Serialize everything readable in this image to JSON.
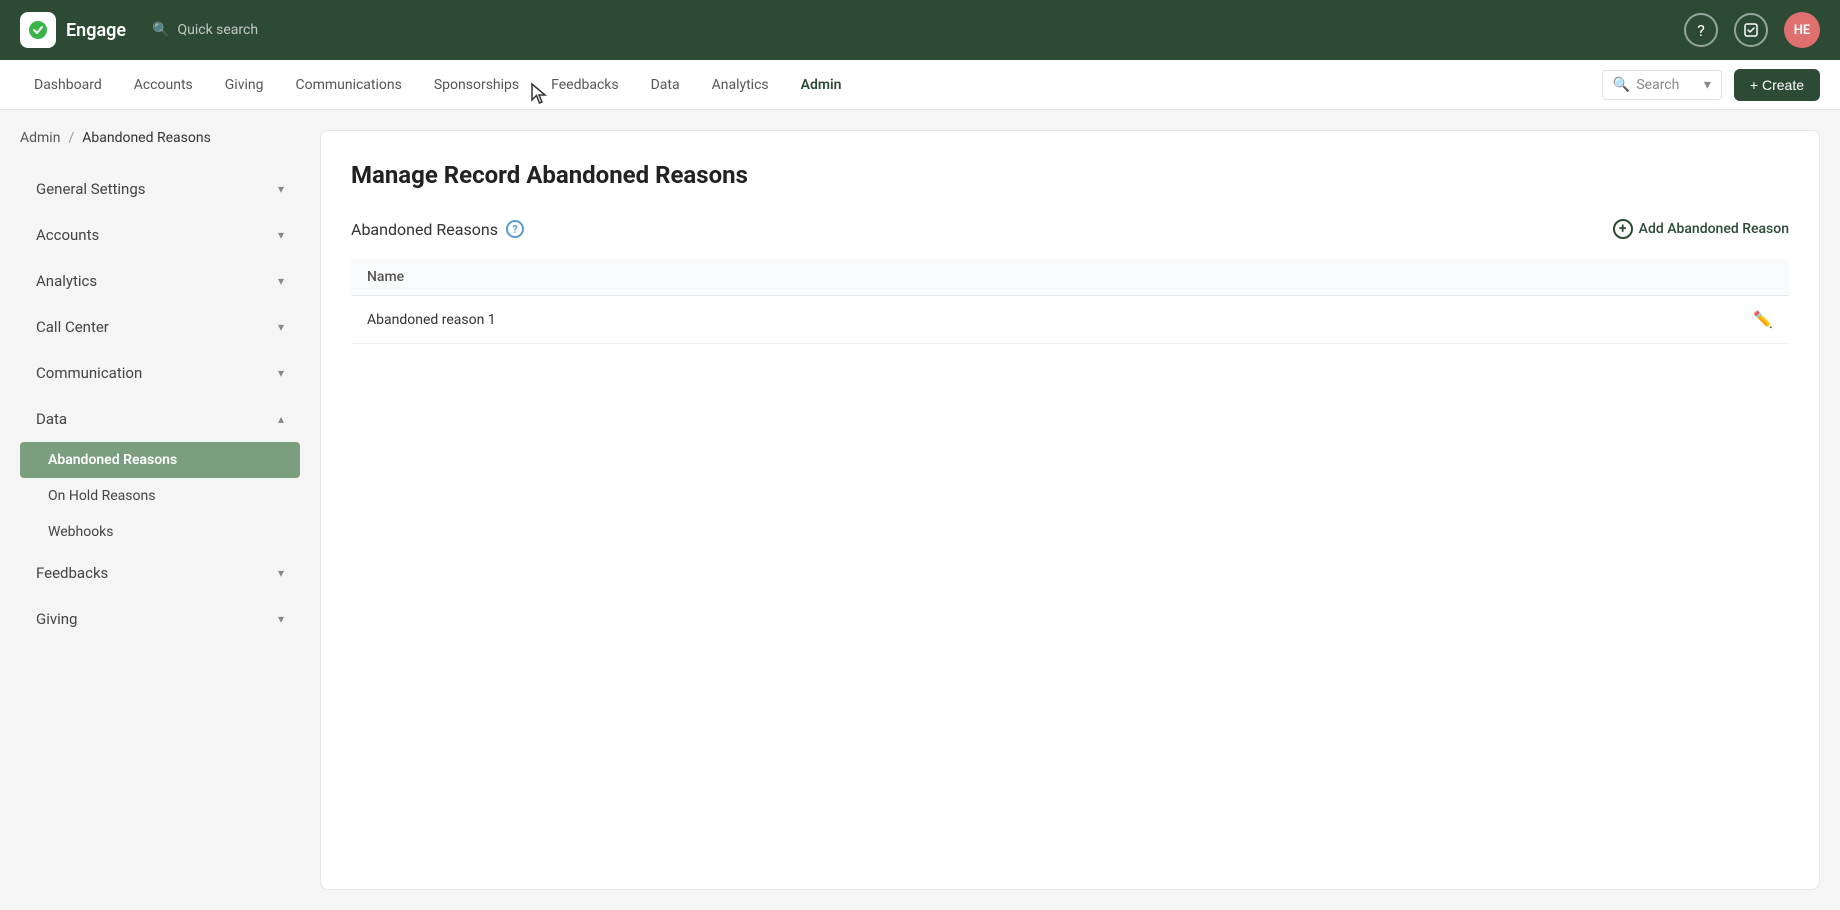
{
  "app": {
    "logo_text": "Engage",
    "user_initials": "HE"
  },
  "topbar": {
    "search_placeholder": "Quick search"
  },
  "navbar": {
    "items": [
      {
        "label": "Dashboard",
        "active": false
      },
      {
        "label": "Accounts",
        "active": false
      },
      {
        "label": "Giving",
        "active": false
      },
      {
        "label": "Communications",
        "active": false
      },
      {
        "label": "Sponsorships",
        "active": false
      },
      {
        "label": "Feedbacks",
        "active": false
      },
      {
        "label": "Data",
        "active": false
      },
      {
        "label": "Analytics",
        "active": false
      },
      {
        "label": "Admin",
        "active": true
      }
    ],
    "search_label": "Search",
    "create_label": "+ Create"
  },
  "breadcrumb": {
    "parent": "Admin",
    "separator": "/",
    "current": "Abandoned Reasons"
  },
  "sidebar": {
    "items": [
      {
        "label": "General Settings",
        "has_chevron": true,
        "expanded": false,
        "active": false
      },
      {
        "label": "Accounts",
        "has_chevron": true,
        "expanded": false,
        "active": false
      },
      {
        "label": "Analytics",
        "has_chevron": true,
        "expanded": false,
        "active": false
      },
      {
        "label": "Call Center",
        "has_chevron": true,
        "expanded": false,
        "active": false
      },
      {
        "label": "Communication",
        "has_chevron": true,
        "expanded": false,
        "active": false
      },
      {
        "label": "Data",
        "has_chevron": true,
        "expanded": true,
        "active": false
      }
    ],
    "subitems": [
      {
        "label": "Abandoned Reasons",
        "active": true
      },
      {
        "label": "On Hold Reasons",
        "active": false
      },
      {
        "label": "Webhooks",
        "active": false
      }
    ],
    "bottom_items": [
      {
        "label": "Feedbacks",
        "has_chevron": true,
        "expanded": false,
        "active": false
      },
      {
        "label": "Giving",
        "has_chevron": true,
        "expanded": false,
        "active": false
      }
    ]
  },
  "main": {
    "title": "Manage Record Abandoned Reasons",
    "section_title": "Abandoned Reasons",
    "add_button_label": "Add Abandoned Reason",
    "table": {
      "columns": [
        "Name"
      ],
      "rows": [
        {
          "name": "Abandoned reason 1"
        }
      ]
    }
  }
}
